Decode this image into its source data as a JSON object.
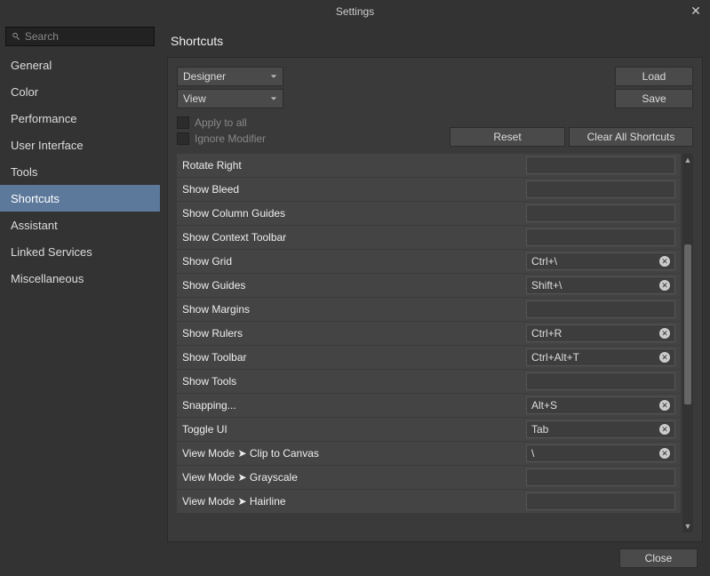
{
  "title": "Settings",
  "search_placeholder": "Search",
  "sidebar": {
    "items": [
      {
        "label": "General"
      },
      {
        "label": "Color"
      },
      {
        "label": "Performance"
      },
      {
        "label": "User Interface"
      },
      {
        "label": "Tools"
      },
      {
        "label": "Shortcuts"
      },
      {
        "label": "Assistant"
      },
      {
        "label": "Linked Services"
      },
      {
        "label": "Miscellaneous"
      }
    ],
    "active_index": 5
  },
  "content_title": "Shortcuts",
  "dropdown1": "Designer",
  "dropdown2": "View",
  "btn_load": "Load",
  "btn_save": "Save",
  "chk_apply": "Apply to all",
  "chk_ignore": "Ignore Modifier",
  "btn_reset": "Reset",
  "btn_clear": "Clear All Shortcuts",
  "rows": [
    {
      "label": "Rotate Right",
      "shortcut": ""
    },
    {
      "label": "Show Bleed",
      "shortcut": ""
    },
    {
      "label": "Show Column Guides",
      "shortcut": ""
    },
    {
      "label": "Show Context Toolbar",
      "shortcut": ""
    },
    {
      "label": "Show Grid",
      "shortcut": "Ctrl+\\"
    },
    {
      "label": "Show Guides",
      "shortcut": "Shift+\\"
    },
    {
      "label": "Show Margins",
      "shortcut": ""
    },
    {
      "label": "Show Rulers",
      "shortcut": "Ctrl+R"
    },
    {
      "label": "Show Toolbar",
      "shortcut": "Ctrl+Alt+T"
    },
    {
      "label": "Show Tools",
      "shortcut": ""
    },
    {
      "label": "Snapping...",
      "shortcut": "Alt+S"
    },
    {
      "label": "Toggle UI",
      "shortcut": "Tab"
    },
    {
      "label": "View Mode ➤ Clip to Canvas",
      "shortcut": "\\"
    },
    {
      "label": "View Mode ➤ Grayscale",
      "shortcut": ""
    },
    {
      "label": "View Mode ➤ Hairline",
      "shortcut": ""
    }
  ],
  "btn_close": "Close"
}
